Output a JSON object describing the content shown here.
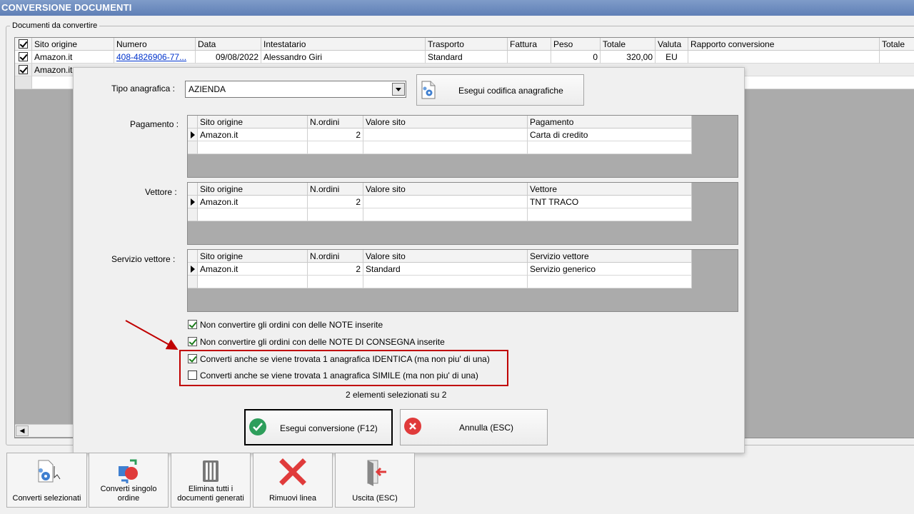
{
  "window": {
    "title": "CONVERSIONE DOCUMENTI"
  },
  "group": {
    "label": "Documenti da convertire"
  },
  "main_grid": {
    "columns": [
      "Sito origine",
      "Numero",
      "Data",
      "Intestatario",
      "Trasporto",
      "Fattura",
      "Peso",
      "Totale",
      "Valuta",
      "Rapporto conversione",
      "Totale"
    ],
    "rows": [
      {
        "checked": true,
        "sito": "Amazon.it",
        "numero": "408-4826906-77...",
        "data": "09/08/2022",
        "intestatario": "Alessandro Giri",
        "trasporto": "Standard",
        "fattura": "",
        "peso": "0",
        "totale": "320,00",
        "valuta": "EU",
        "rapporto": "",
        "totale2": ""
      },
      {
        "checked": true,
        "sito": "Amazon.it"
      }
    ]
  },
  "dialog": {
    "tipo_label": "Tipo anagrafica :",
    "tipo_value": "AZIENDA",
    "codifica_button": "Esegui codifica anagrafiche",
    "pagamento": {
      "label": "Pagamento :",
      "columns": [
        "Sito origine",
        "N.ordini",
        "Valore sito",
        "Pagamento"
      ],
      "row": [
        "Amazon.it",
        "2",
        "",
        "Carta di credito"
      ]
    },
    "vettore": {
      "label": "Vettore :",
      "columns": [
        "Sito origine",
        "N.ordini",
        "Valore sito",
        "Vettore"
      ],
      "row": [
        "Amazon.it",
        "2",
        "",
        "TNT TRACO"
      ]
    },
    "servizio": {
      "label": "Servizio vettore :",
      "columns": [
        "Sito origine",
        "N.ordini",
        "Valore sito",
        "Servizio vettore"
      ],
      "row": [
        "Amazon.it",
        "2",
        "Standard",
        "Servizio generico"
      ]
    },
    "options": [
      {
        "label": "Non convertire gli ordini con delle NOTE inserite",
        "checked": true
      },
      {
        "label": "Non convertire gli ordini con delle NOTE DI CONSEGNA inserite",
        "checked": true
      },
      {
        "label": "Converti anche se viene trovata 1 anagrafica IDENTICA (ma non piu' di una)",
        "checked": true
      },
      {
        "label": "Converti anche se viene trovata 1 anagrafica SIMILE (ma non piu' di una)",
        "checked": false
      }
    ],
    "selection_status": "2 elementi selezionati su 2",
    "esegui_button": "Esegui conversione (F12)",
    "annulla_button": "Annulla (ESC)"
  },
  "toolbar": {
    "converti_selezionati": "Converti selezionati",
    "converti_singolo": [
      "Converti singolo",
      "ordine"
    ],
    "elimina_tutti": [
      "Elimina tutti i",
      "documenti generati"
    ],
    "rimuovi_linea": "Rimuovi linea",
    "uscita": "Uscita (ESC)"
  },
  "colors": {
    "title_bar": "#6a8bc0",
    "highlight_border": "#c00000",
    "arrow": "#c00000",
    "ok_green": "#2e9e5b",
    "cancel_red": "#e03b3b"
  }
}
